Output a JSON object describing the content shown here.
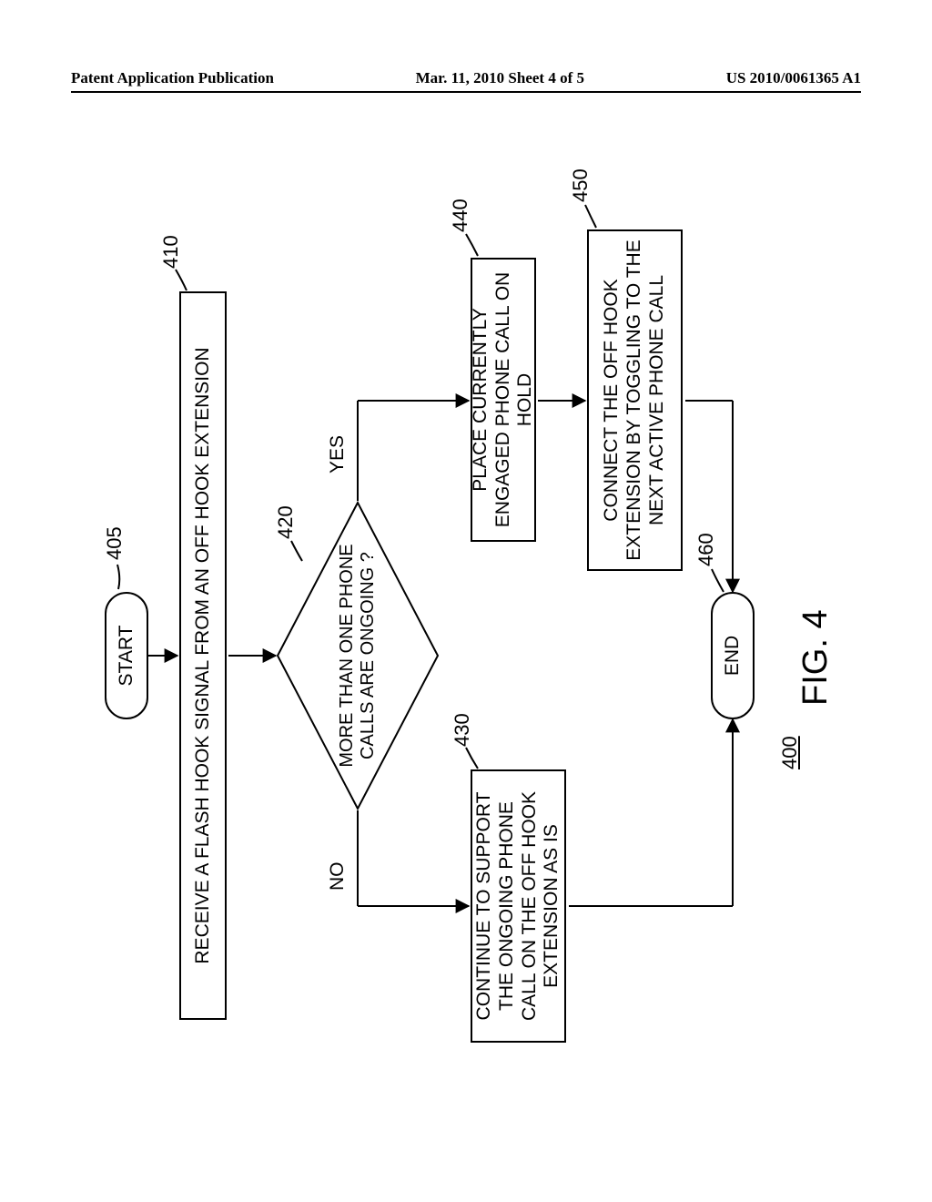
{
  "header": {
    "left": "Patent Application Publication",
    "center": "Mar. 11, 2010  Sheet 4 of 5",
    "right": "US 2010/0061365 A1"
  },
  "flow": {
    "start": "START",
    "end": "END",
    "box410": "RECEIVE A FLASH HOOK SIGNAL FROM AN OFF HOOK EXTENSION",
    "dec420": "MORE THAN ONE PHONE CALLS ARE ONGOING ?",
    "box430": "CONTINUE TO SUPPORT THE ONGOING PHONE CALL ON THE OFF HOOK EXTENSION AS IS",
    "box440": "PLACE CURRENTLY ENGAGED PHONE CALL ON HOLD",
    "box450": "CONNECT THE OFF HOOK EXTENSION BY TOGGLING TO THE NEXT ACTIVE PHONE CALL",
    "no": "NO",
    "yes": "YES"
  },
  "refs": {
    "r405": "405",
    "r410": "410",
    "r420": "420",
    "r430": "430",
    "r440": "440",
    "r450": "450",
    "r460": "460",
    "r400": "400"
  },
  "figcaption": "FIG. 4"
}
